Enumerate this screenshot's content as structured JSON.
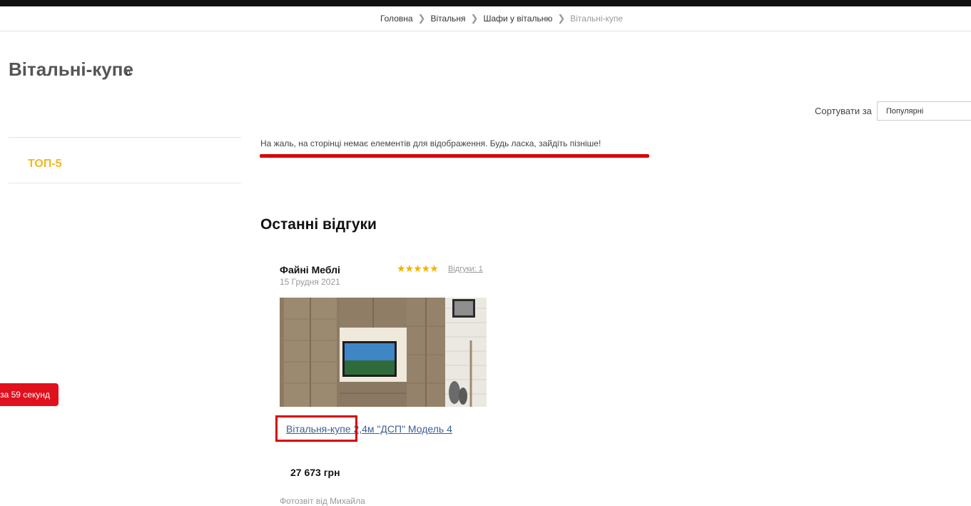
{
  "breadcrumb": {
    "items": [
      "Головна",
      "Вітальня",
      "Шафи у вітальню"
    ],
    "current": "Вітальні-купе"
  },
  "page": {
    "title": "Вітальні-купе",
    "count": "0"
  },
  "sort": {
    "label": "Сортувати за",
    "selected": "Популярні"
  },
  "sidebar": {
    "top5_label": "ТОП-5"
  },
  "empty_message": "На жаль, на сторінці немає елементів для відображення. Будь ласка, зайдіть пізніше!",
  "reviews": {
    "title": "Останні відгуки",
    "items": [
      {
        "author": "Файні Меблі",
        "date": "15 Грудня 2021",
        "rating": 5,
        "stars": "★★★★★",
        "count_label": "Відгуки: 1",
        "product_link": "Вітальня-купе 2,4м \"ДСП\" Модель 4",
        "price": "27 673 грн",
        "photo_caption": "Фотозвіт від Михайла"
      }
    ]
  },
  "timer": {
    "text": "за 59 секунд"
  },
  "colors": {
    "accent_red": "#d9000d",
    "star_yellow": "#f4b400",
    "top5_yellow": "#f2b824",
    "link_blue": "#3b5f94"
  }
}
